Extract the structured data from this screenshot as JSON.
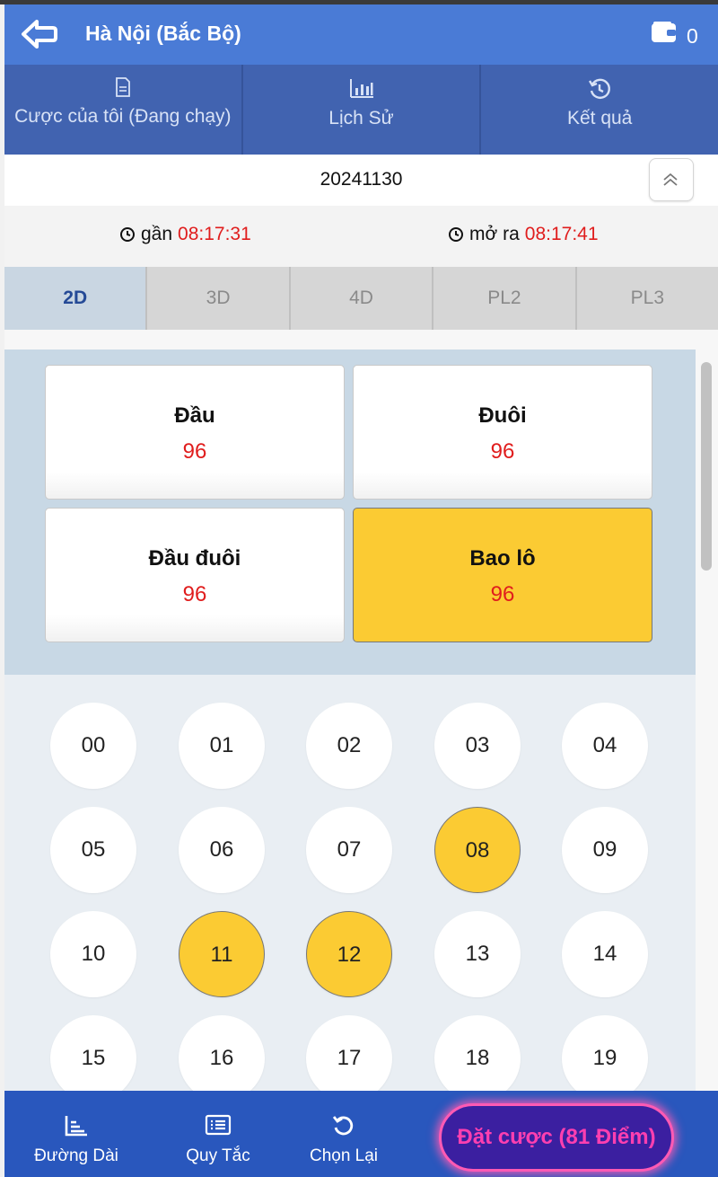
{
  "header": {
    "title": "Hà Nội (Bắc Bộ)",
    "wallet_count": "0",
    "icons": {
      "back": "back-arrow-icon",
      "wallet": "wallet-icon"
    }
  },
  "top_tabs": [
    {
      "label": "Cược của tôi (Đang chạy)",
      "icon": "document-icon"
    },
    {
      "label": "Lịch Sử",
      "icon": "bar-chart-icon"
    },
    {
      "label": "Kết quả",
      "icon": "history-icon"
    }
  ],
  "period": {
    "date": "20241130",
    "collapse_icon": "chevron-up-icon"
  },
  "timers": [
    {
      "label": "gần",
      "time": "08:17:31",
      "icon": "clock-icon"
    },
    {
      "label": "mở ra",
      "time": "08:17:41",
      "icon": "clock-icon"
    }
  ],
  "game_tabs": [
    {
      "label": "2D",
      "active": true
    },
    {
      "label": "3D",
      "active": false
    },
    {
      "label": "4D",
      "active": false
    },
    {
      "label": "PL2",
      "active": false
    },
    {
      "label": "PL3",
      "active": false
    }
  ],
  "bet_types": [
    {
      "name": "Đầu",
      "value": "96",
      "selected": false
    },
    {
      "name": "Đuôi",
      "value": "96",
      "selected": false
    },
    {
      "name": "Đầu đuôi",
      "value": "96",
      "selected": false
    },
    {
      "name": "Bao lô",
      "value": "96",
      "selected": true
    }
  ],
  "numbers": [
    {
      "label": "00",
      "selected": false
    },
    {
      "label": "01",
      "selected": false
    },
    {
      "label": "02",
      "selected": false
    },
    {
      "label": "03",
      "selected": false
    },
    {
      "label": "04",
      "selected": false
    },
    {
      "label": "05",
      "selected": false
    },
    {
      "label": "06",
      "selected": false
    },
    {
      "label": "07",
      "selected": false
    },
    {
      "label": "08",
      "selected": true
    },
    {
      "label": "09",
      "selected": false
    },
    {
      "label": "10",
      "selected": false
    },
    {
      "label": "11",
      "selected": true
    },
    {
      "label": "12",
      "selected": true
    },
    {
      "label": "13",
      "selected": false
    },
    {
      "label": "14",
      "selected": false
    },
    {
      "label": "15",
      "selected": false
    },
    {
      "label": "16",
      "selected": false
    },
    {
      "label": "17",
      "selected": false
    },
    {
      "label": "18",
      "selected": false
    },
    {
      "label": "19",
      "selected": false
    }
  ],
  "bottom_bar": {
    "items": [
      {
        "label": "Đường Dài",
        "icon": "trend-chart-icon"
      },
      {
        "label": "Quy Tắc",
        "icon": "list-icon"
      },
      {
        "label": "Chọn Lại",
        "icon": "reset-icon"
      }
    ],
    "bet_button": "Đặt cược (81 Điểm)"
  },
  "colors": {
    "header_blue": "#4a7bd6",
    "tab_blue": "#4163b0",
    "bottom_blue": "#2957bd",
    "selected_yellow": "#fbcb33",
    "odds_red": "#e01d1d",
    "bet_button_pink": "#ff3fb0"
  }
}
